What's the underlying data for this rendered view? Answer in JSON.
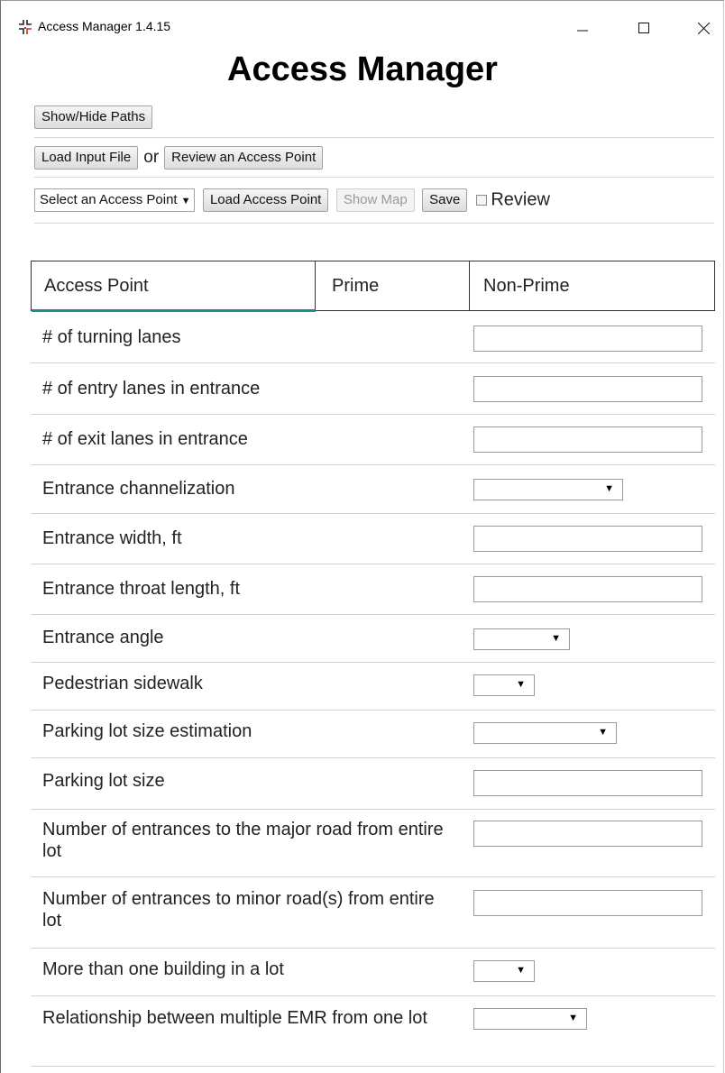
{
  "window": {
    "title": "Access Manager 1.4.15",
    "controls": {
      "minimize": "—",
      "maximize": "☐",
      "close": "✕"
    }
  },
  "app": {
    "heading": "Access Manager"
  },
  "toolbar": {
    "show_hide_paths": "Show/Hide Paths",
    "load_input_file": "Load Input File",
    "or_text": "or",
    "review_access_point": "Review an Access Point",
    "access_point_select": "Select an Access Point",
    "load_access_point": "Load Access Point",
    "show_map": "Show Map",
    "save": "Save",
    "review_label": "Review",
    "review_checked": false
  },
  "table": {
    "headers": [
      "Access Point",
      "Prime",
      "Non-Prime"
    ],
    "rows": [
      {
        "label": "# of turning lanes",
        "control": "input",
        "value": ""
      },
      {
        "label": "# of entry lanes in entrance",
        "control": "input",
        "value": ""
      },
      {
        "label": "# of exit lanes in entrance",
        "control": "input",
        "value": ""
      },
      {
        "label": "Entrance channelization",
        "control": "select",
        "value": ""
      },
      {
        "label": "Entrance width, ft",
        "control": "input",
        "value": ""
      },
      {
        "label": "Entrance throat length, ft",
        "control": "input",
        "value": ""
      },
      {
        "label": "Entrance angle",
        "control": "select",
        "value": ""
      },
      {
        "label": "Pedestrian sidewalk",
        "control": "select",
        "value": ""
      },
      {
        "label": "Parking lot size estimation",
        "control": "select",
        "value": ""
      },
      {
        "label": "Parking lot size",
        "control": "input",
        "value": ""
      },
      {
        "label": "Number of entrances to the major road from entire lot",
        "control": "input",
        "value": ""
      },
      {
        "label": "Number of entrances to minor road(s) from entire lot",
        "control": "input",
        "value": ""
      },
      {
        "label": "More than one building in a lot",
        "control": "select",
        "value": ""
      },
      {
        "label": "Relationship between multiple EMR from one lot",
        "control": "select",
        "value": ""
      }
    ]
  },
  "colors": {
    "accent_underline": "#1f8f86"
  },
  "icons": {
    "app": "access-manager-logo-icon",
    "dropdown": "caret-down-icon"
  }
}
